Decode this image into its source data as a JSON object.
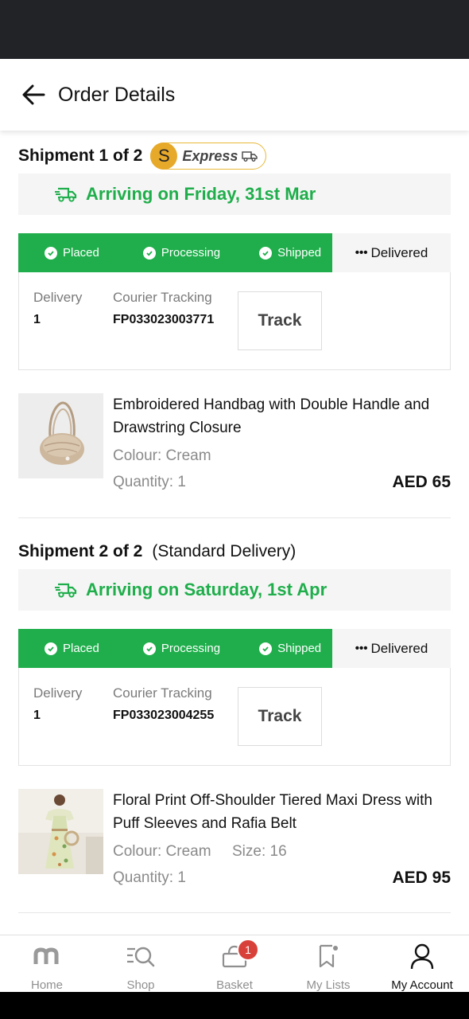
{
  "header": {
    "title": "Order Details"
  },
  "shipments": [
    {
      "title": "Shipment 1 of 2",
      "note": "",
      "badge": {
        "letter": "S",
        "label": "Express"
      },
      "arrival": "Arriving on Friday, 31st Mar",
      "steps": [
        "Placed",
        "Processing",
        "Shipped"
      ],
      "pending_step": "Delivered",
      "delivery_label": "Delivery",
      "delivery_value": "1",
      "courier_label": "Courier Tracking",
      "courier_value": "FP033023003771",
      "track_label": "Track",
      "product": {
        "name": "Embroidered Handbag with Double Handle and Drawstring Closure",
        "colour": "Colour: Cream",
        "size": "",
        "quantity": "Quantity: 1",
        "price": "AED 65"
      }
    },
    {
      "title": "Shipment 2 of 2",
      "note": "(Standard Delivery)",
      "arrival": "Arriving on Saturday, 1st Apr",
      "steps": [
        "Placed",
        "Processing",
        "Shipped"
      ],
      "pending_step": "Delivered",
      "delivery_label": "Delivery",
      "delivery_value": "1",
      "courier_label": "Courier Tracking",
      "courier_value": "FP033023004255",
      "track_label": "Track",
      "product": {
        "name": "Floral Print Off-Shoulder Tiered Maxi Dress with Puff Sleeves and Rafia Belt",
        "colour": "Colour: Cream",
        "size": "Size: 16",
        "quantity": "Quantity: 1",
        "price": "AED 95"
      }
    }
  ],
  "tabbar": {
    "items": [
      {
        "label": "Home",
        "icon": "home-m-logo-icon"
      },
      {
        "label": "Shop",
        "icon": "shop-search-icon"
      },
      {
        "label": "Basket",
        "icon": "basket-icon",
        "badge": "1"
      },
      {
        "label": "My Lists",
        "icon": "bookmark-icon"
      },
      {
        "label": "My Account",
        "icon": "account-icon",
        "active": true
      }
    ]
  },
  "colors": {
    "accent_green": "#1fae4b",
    "express_gold": "#e7a92a",
    "badge_red": "#d8413a"
  }
}
